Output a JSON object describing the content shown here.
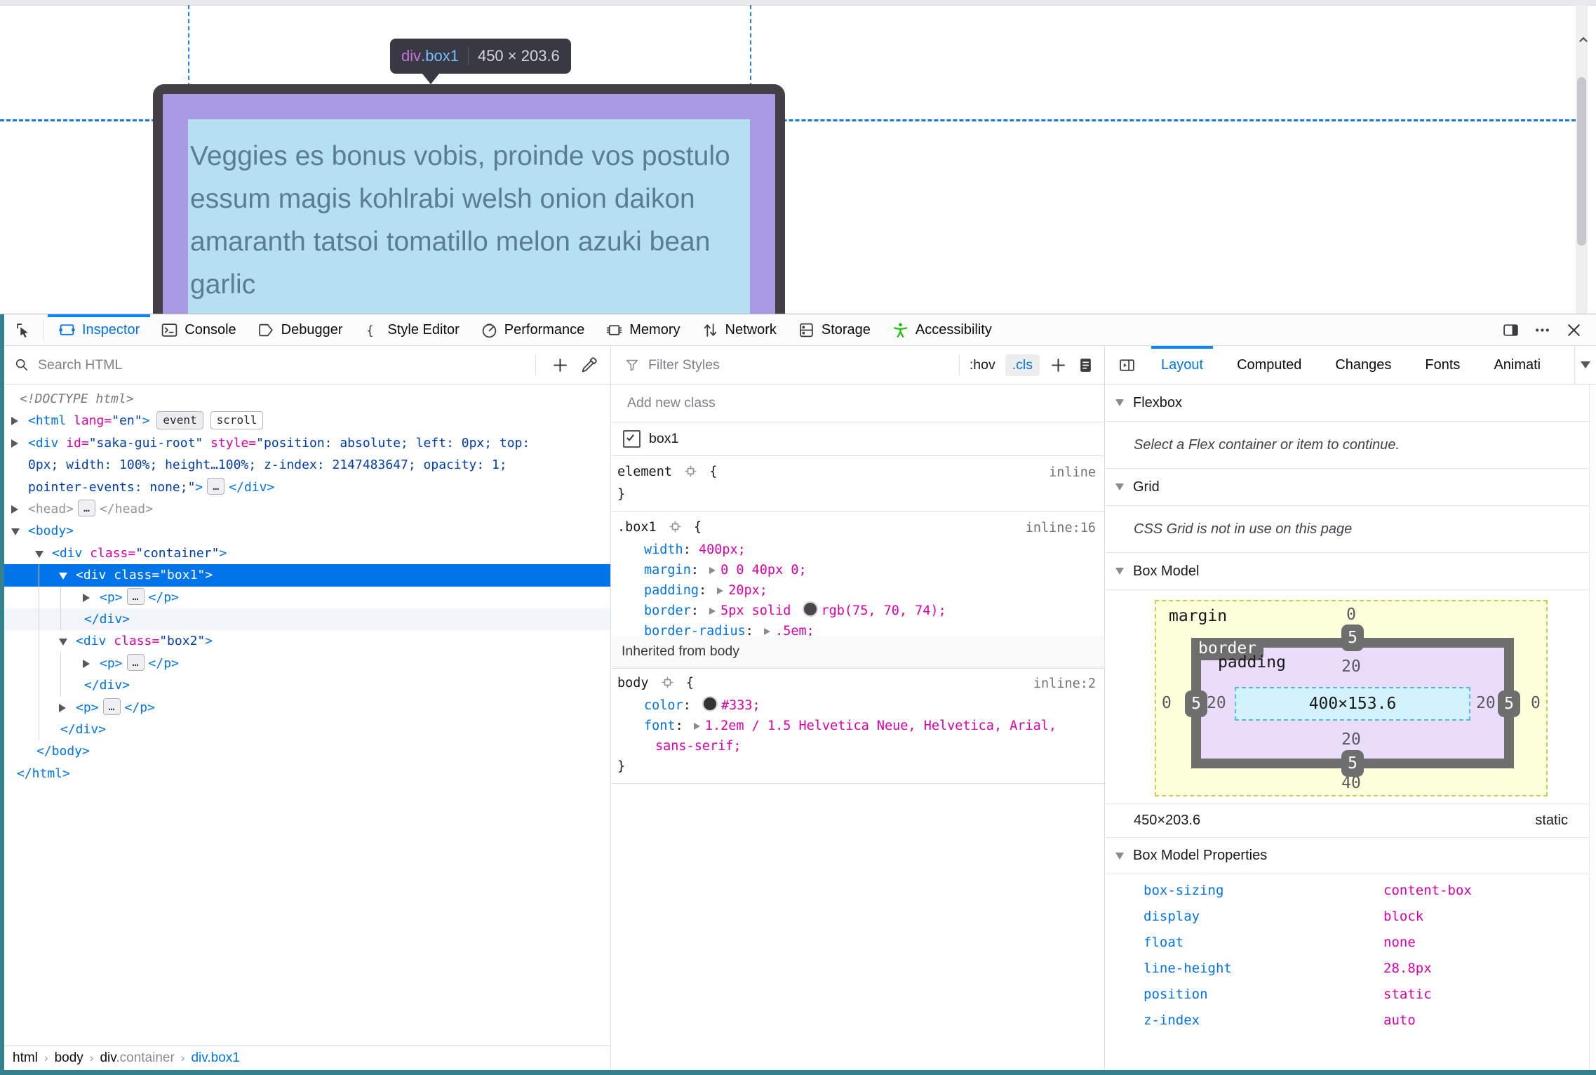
{
  "page": {
    "tooltip": {
      "tag": "div",
      "class": ".box1",
      "sep": "|",
      "dims": "450 × 203.6"
    },
    "content_lines": [
      "Veggies es bonus vobis, proinde vos postulo",
      "essum magis kohlrabi welsh onion daikon",
      "amaranth tatsoi tomatillo melon azuki bean",
      "garlic"
    ]
  },
  "devtools": {
    "tabs": [
      {
        "label": "Inspector",
        "icon": "inspector",
        "active": true
      },
      {
        "label": "Console",
        "icon": "console"
      },
      {
        "label": "Debugger",
        "icon": "debugger"
      },
      {
        "label": "Style Editor",
        "icon": "style-editor"
      },
      {
        "label": "Performance",
        "icon": "performance"
      },
      {
        "label": "Memory",
        "icon": "memory"
      },
      {
        "label": "Network",
        "icon": "network"
      },
      {
        "label": "Storage",
        "icon": "storage"
      },
      {
        "label": "Accessibility",
        "icon": "accessibility",
        "color": "#12bc00"
      }
    ],
    "right_icons": [
      {
        "icon": "split-console"
      },
      {
        "icon": "meatballs"
      },
      {
        "icon": "close"
      }
    ]
  },
  "markup": {
    "search_placeholder": "Search HTML",
    "lines": [
      {
        "ix": 28,
        "seg": [
          {
            "c": "c-dimi",
            "t": "<!DOCTYPE html>"
          }
        ]
      },
      {
        "d": 0,
        "e": "closed",
        "seg": [
          {
            "c": "c-tag",
            "t": "<html"
          },
          {
            "c": "c-attr",
            "t": " lang="
          },
          {
            "c": "c-val",
            "t": "\"en\""
          },
          {
            "c": "c-tag",
            "t": ">"
          }
        ],
        "badges": [
          {
            "t": "event",
            "f": true
          },
          {
            "t": "scroll",
            "f": false
          }
        ]
      },
      {
        "d": 0,
        "e": "closed",
        "seg": [
          {
            "c": "c-tag",
            "t": "<div"
          },
          {
            "c": "c-attr",
            "t": " id="
          },
          {
            "c": "c-val",
            "t": "\"saka-gui-root\""
          },
          {
            "c": "c-attr",
            "t": " style="
          },
          {
            "c": "c-val",
            "t": "\"position: absolute; left: 0px; top:"
          }
        ]
      },
      {
        "ix": 40,
        "seg": [
          {
            "c": "c-val",
            "t": "0px; width: 100%; height…100%; z-index: 2147483647; opacity: 1;"
          }
        ]
      },
      {
        "ix": 40,
        "seg": [
          {
            "c": "c-val",
            "t": "pointer-events: none;\""
          },
          {
            "c": "c-tag",
            "t": ">"
          },
          {
            "chip": "…"
          },
          {
            "c": "c-tag",
            "t": "</div>"
          }
        ]
      },
      {
        "d": 0,
        "e": "closed",
        "seg": [
          {
            "c": "c-dim",
            "t": "<head>"
          },
          {
            "chip": "…"
          },
          {
            "c": "c-dim",
            "t": "</head>"
          }
        ]
      },
      {
        "d": 0,
        "e": "open",
        "seg": [
          {
            "c": "c-tag",
            "t": "<body>"
          }
        ]
      },
      {
        "d": 1,
        "e": "open",
        "seg": [
          {
            "c": "c-tag",
            "t": "<div"
          },
          {
            "c": "c-attr",
            "t": " class="
          },
          {
            "c": "c-val",
            "t": "\"container\""
          },
          {
            "c": "c-tag",
            "t": ">"
          }
        ]
      },
      {
        "d": 2,
        "e": "open",
        "sel": true,
        "seg": [
          {
            "c": "c-tag",
            "t": "<div"
          },
          {
            "c": "c-attr",
            "t": " class="
          },
          {
            "c": "c-val",
            "t": "\"box1\""
          },
          {
            "c": "c-tag",
            "t": ">"
          }
        ]
      },
      {
        "d": 3,
        "e": "closed",
        "seg": [
          {
            "c": "c-tag",
            "t": "<p>"
          },
          {
            "chip": "…"
          },
          {
            "c": "c-tag",
            "t": "</p>"
          }
        ]
      },
      {
        "ix": 120,
        "lite": true,
        "seg": [
          {
            "c": "c-tag",
            "t": "</div>"
          }
        ]
      },
      {
        "d": 2,
        "e": "open",
        "seg": [
          {
            "c": "c-tag",
            "t": "<div"
          },
          {
            "c": "c-attr",
            "t": " class="
          },
          {
            "c": "c-val",
            "t": "\"box2\""
          },
          {
            "c": "c-tag",
            "t": ">"
          }
        ]
      },
      {
        "d": 3,
        "e": "closed",
        "seg": [
          {
            "c": "c-tag",
            "t": "<p>"
          },
          {
            "chip": "…"
          },
          {
            "c": "c-tag",
            "t": "</p>"
          }
        ]
      },
      {
        "ix": 120,
        "seg": [
          {
            "c": "c-tag",
            "t": "</div>"
          }
        ]
      },
      {
        "d": 2,
        "e": "closed",
        "seg": [
          {
            "c": "c-tag",
            "t": "<p>"
          },
          {
            "chip": "…"
          },
          {
            "c": "c-tag",
            "t": "</p>"
          }
        ]
      },
      {
        "ix": 86,
        "seg": [
          {
            "c": "c-tag",
            "t": "</div>"
          }
        ]
      },
      {
        "ix": 52,
        "seg": [
          {
            "c": "c-tag",
            "t": "</body>"
          }
        ]
      },
      {
        "ix": 24,
        "seg": [
          {
            "c": "c-tag",
            "t": "</html>"
          }
        ]
      }
    ],
    "breadcrumb": [
      {
        "t": "html"
      },
      {
        "t": "body"
      },
      {
        "t": "div",
        "dim": ".container"
      },
      {
        "t": "div.box1",
        "active": true
      }
    ]
  },
  "rules": {
    "filter_placeholder": "Filter Styles",
    "pseudo_label": ":hov",
    "class_label": ".cls",
    "add_class_placeholder": "Add new class",
    "toggle_class": "box1",
    "blocks": [
      {
        "selector": "element",
        "loc": "inline",
        "props": []
      },
      {
        "selector": ".box1",
        "loc": "inline:16",
        "props": [
          {
            "name": "width",
            "value": "400px"
          },
          {
            "name": "margin",
            "exp": true,
            "value": "0 0 40px 0"
          },
          {
            "name": "padding",
            "exp": true,
            "value": "20px"
          },
          {
            "name": "border",
            "exp": true,
            "pre": "5px solid ",
            "swatch": "#4b464a",
            "value": "rgb(75, 70, 74)"
          },
          {
            "name": "border-radius",
            "exp": true,
            "value": ".5em"
          }
        ]
      }
    ],
    "inherited_header": "Inherited from body",
    "inherited_block": {
      "selector": "body",
      "loc": "inline:2",
      "props": [
        {
          "name": "color",
          "swatch": "#333",
          "value": "#333"
        },
        {
          "name": "font",
          "exp": true,
          "value": "1.2em / 1.5 Helvetica Neue, Helvetica, Arial,",
          "wrap": "sans-serif;"
        }
      ]
    }
  },
  "layout": {
    "tabs": [
      {
        "label": "Layout",
        "active": true
      },
      {
        "label": "Computed"
      },
      {
        "label": "Changes"
      },
      {
        "label": "Fonts"
      },
      {
        "label": "Animati"
      }
    ],
    "flexbox_header": "Flexbox",
    "flexbox_msg": "Select a Flex container or item to continue.",
    "grid_header": "Grid",
    "grid_msg": "CSS Grid is not in use on this page",
    "boxmodel_header": "Box Model",
    "box_model": {
      "margin_label": "margin",
      "border_label": "border",
      "padding_label": "padding",
      "content": "400×153.6",
      "margin": {
        "top": "0",
        "right": "0",
        "bottom": "40",
        "left": "0"
      },
      "border": {
        "top": "5",
        "right": "5",
        "bottom": "5",
        "left": "5"
      },
      "padding": {
        "top": "20",
        "right": "20",
        "bottom": "20",
        "left": "20"
      }
    },
    "dims": "450×203.6",
    "position": "static",
    "props_header": "Box Model Properties",
    "props": [
      {
        "name": "box-sizing",
        "value": "content-box"
      },
      {
        "name": "display",
        "value": "block"
      },
      {
        "name": "float",
        "value": "none"
      },
      {
        "name": "line-height",
        "value": "28.8px"
      },
      {
        "name": "position",
        "value": "static"
      },
      {
        "name": "z-index",
        "value": "auto"
      }
    ]
  }
}
